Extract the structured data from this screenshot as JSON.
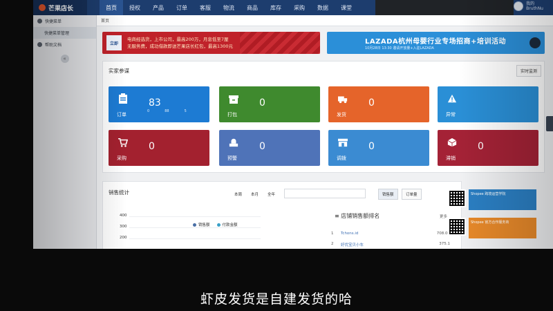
{
  "topbar": {
    "logo_text": "芒果店长",
    "nav": [
      "首页",
      "授权",
      "产品",
      "订单",
      "客服",
      "物流",
      "商品",
      "库存",
      "采购",
      "数据",
      "课堂"
    ],
    "user_name": "我的",
    "user_sub": "BruthNu"
  },
  "sidebar": {
    "items": [
      {
        "label": "快捷菜单",
        "icon": "minus-circle-icon"
      },
      {
        "label": "快捷菜单管理",
        "icon": ""
      },
      {
        "label": "帮助文档",
        "icon": "help-circle-icon"
      }
    ],
    "toggle": "«"
  },
  "breadcrumb": "首页",
  "banners": {
    "left": {
      "logo": "立即",
      "line1": "电商经选货，上市公司，最高200万，月息低至7厘",
      "line2": "无服务费，成功借款即送芒果店长红包，最高1300元"
    },
    "right": {
      "title": "LAZADA杭州母婴行业专场招商+培训活动",
      "sub": "10月28日 13:30  邀请开放量+入驻LAZADA"
    }
  },
  "panel": {
    "title": "实家参谋",
    "tab": "实时监测",
    "tiles": [
      {
        "label": "订单",
        "value": "83",
        "sub": [
          "0",
          "88",
          "5"
        ],
        "color": "#1d7bd3",
        "icon": "clipboard-icon"
      },
      {
        "label": "打包",
        "value": "0",
        "color": "#3f8a2e",
        "icon": "box-icon"
      },
      {
        "label": "发货",
        "value": "0",
        "color": "#e5642a",
        "icon": "truck-icon"
      },
      {
        "label": "异常",
        "value": "",
        "color": "#2a8fd6",
        "icon": "warning-icon"
      },
      {
        "label": "采购",
        "value": "0",
        "color": "#a3212f",
        "icon": "cart-icon"
      },
      {
        "label": "预警",
        "value": "0",
        "color": "#4f73b8",
        "icon": "alert-box-icon"
      },
      {
        "label": "调拨",
        "value": "0",
        "color": "#3b8bd2",
        "icon": "store-icon"
      },
      {
        "label": "滞销",
        "value": "0",
        "color": "#a42236",
        "icon": "cube-icon"
      }
    ]
  },
  "sales": {
    "title": "销售统计",
    "ranges": [
      "本周",
      "本月",
      "全年"
    ],
    "buttons": [
      "销售额",
      "订单量"
    ],
    "yticks": [
      "400",
      "300",
      "200"
    ],
    "legend": [
      {
        "label": "销售额",
        "color": "#4a6fa5"
      },
      {
        "label": "付款金额",
        "color": "#3aa0c8"
      }
    ],
    "rank_title": "店铺销售额排名",
    "rank_more": "更多",
    "rank_rows": [
      {
        "rank": "1",
        "name": "Tchons.id",
        "value": "708.00"
      },
      {
        "rank": "2",
        "name": "好优宝贝小车",
        "value": "375.1"
      }
    ]
  },
  "promo": [
    {
      "text": "Shopee 跨境运营学院",
      "color": "#2b7fc3"
    },
    {
      "text": "Shopee 官方合作服务商",
      "color": "#e7892a"
    }
  ],
  "subtitle": "虾皮发货是自建发货的哈"
}
